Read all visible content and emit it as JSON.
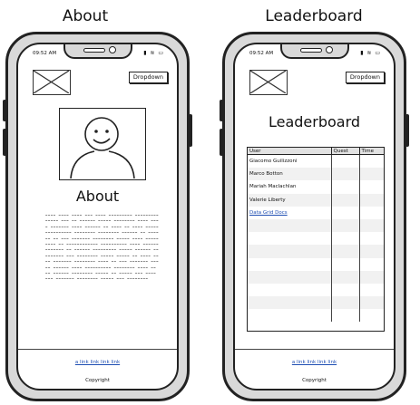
{
  "screens": [
    {
      "label": "About",
      "status_time": "09:52 AM",
      "status_icons": "▮ ≋ ▭",
      "dropdown": "Dropdown",
      "heading": "About",
      "body_text": "~~~~ ~~~~ ~~~~ ~~~ ~~~~ ~~~~~~~~~ ~~~~~~~~~ ~~~~~ ~~~ ~~ ~~~~~~ ~~~~~ ~~~~~~~~ ~~~~ ~~~~ ~~~~~~~ ~~~~ ~~~~~~ ~~ ~~~~ ~~ ~~~~ ~~~~~ ~~~~~~~~~~ ~~~~~~~~ ~~~~~~~~ ~~~~~~ ~~ ~~~~~~ ~~ ~~~ ~~~~~~~ ~~~~~~~~ ~~~~~ ~~~~ ~~~~~ ~~~~ ~~ ~~~~~~~~~~~~ ~~~~~~~~~~ ~~~~ ~~~~~~ ~~~~~~~ ~~ ~~~~~~ ~~~~~~~~~ ~~~~~ ~~~~~~ ~~~~~~~~~ ~~~ ~~~~~~~~ ~~~~~ ~~~~~ ~~ ~~~~ ~~~~ ~~~~~~~ ~~~~~~~~ ~~~~ ~~ ~~~ ~~~~~~~ ~~~~~ ~~~~~~ ~~~~ ~~~~~~~~~~ ~~~~~~~~ ~~~~ ~~ ~~ ~~~~~~ ~~~~~~~~ ~~~~~ ~~ ~~~~~ ~~~ ~~~~ ~~~ ~~~~~~~ ~~~~~~~~ ~~~~~ ~~~ ~~~~~~~~",
      "footer_link": "a link link link link",
      "copyright": "Copyright"
    },
    {
      "label": "Leaderboard",
      "status_time": "09:52 AM",
      "status_icons": "▮ ≋ ▭",
      "dropdown": "Dropdown",
      "heading": "Leaderboard",
      "columns": [
        "User",
        "Quest",
        "Time"
      ],
      "rows": [
        "Giacomo Guilizzoni",
        "Marco Botton",
        "Mariah Maclachlan",
        "Valerie Liberty"
      ],
      "grid_link": "Data Grid Docs",
      "footer_link": "a link link link link",
      "copyright": "Copyright"
    }
  ]
}
